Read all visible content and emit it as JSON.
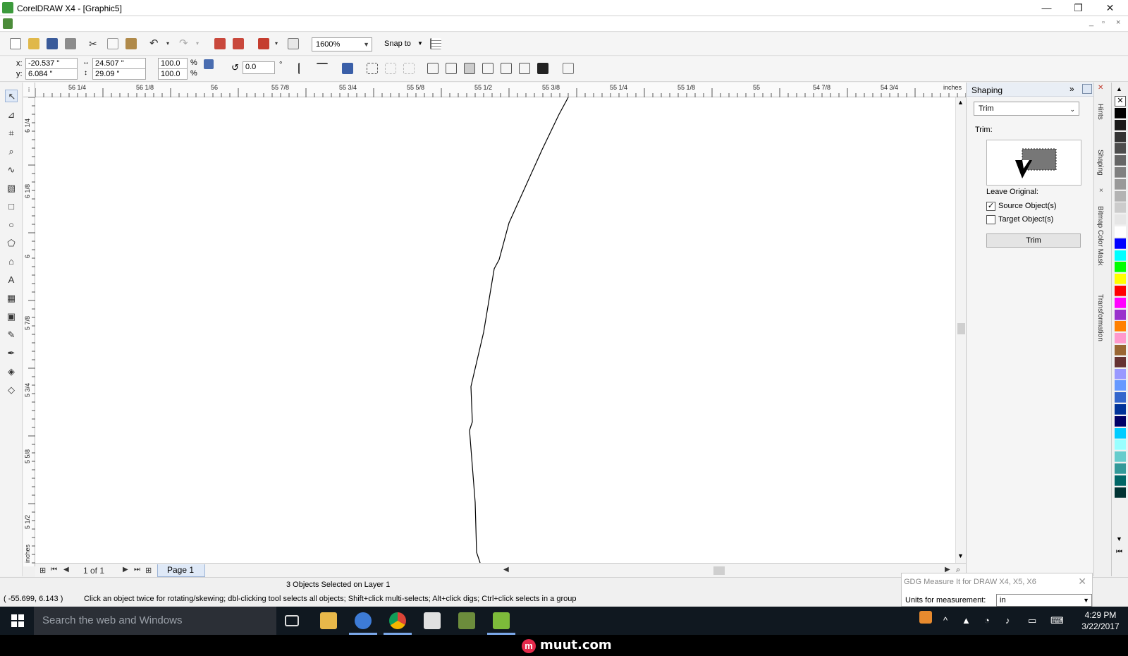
{
  "window": {
    "title": "CorelDRAW X4 - [Graphic5]",
    "minimize": "—",
    "restore": "❐",
    "close": "✕"
  },
  "toolbar": {
    "zoom": "1600%",
    "snap_to": "Snap to"
  },
  "properties": {
    "x_label": "x:",
    "x_value": "-20.537 \"",
    "y_label": "y:",
    "y_value": "6.084 \"",
    "width_value": "24.507 \"",
    "height_value": "29.09 \"",
    "scale_x": "100.0",
    "scale_y": "100.0",
    "percent": "%",
    "rotation": "0.0",
    "degree": "°"
  },
  "hruler": {
    "labels": [
      "56 1/4",
      "56 1/8",
      "56",
      "55 7/8",
      "55 3/4",
      "55 5/8",
      "55 1/2",
      "55 3/8",
      "55 1/4",
      "55 1/8",
      "55",
      "54 7/8",
      "54 3/4"
    ],
    "unit": "inches"
  },
  "vruler": {
    "labels": [
      "6 1/4",
      "6 1/8",
      "6",
      "5 7/8",
      "5 3/4",
      "5 5/8",
      "5 1/2"
    ],
    "unit": "inches"
  },
  "page_nav": {
    "count": "1 of 1",
    "tab": "Page 1"
  },
  "docker": {
    "title": "Shaping",
    "mode": "Trim",
    "section_label": "Trim:",
    "leave_original": "Leave Original:",
    "source_label": "Source Object(s)",
    "source_checked": true,
    "target_label": "Target Object(s)",
    "target_checked": false,
    "button": "Trim"
  },
  "side_tabs": [
    "Hints",
    "Shaping",
    "Bitmap Color Mask",
    "Transformation"
  ],
  "palette": [
    "#000000",
    "#1a1a1a",
    "#333333",
    "#4d4d4d",
    "#666666",
    "#808080",
    "#999999",
    "#b3b3b3",
    "#cccccc",
    "#e6e6e6",
    "#ffffff",
    "#0000ff",
    "#00ffff",
    "#00ff00",
    "#ffff00",
    "#ff0000",
    "#ff00ff",
    "#9933cc",
    "#ff8000",
    "#ff99cc",
    "#996633",
    "#663333",
    "#9999ff",
    "#6699ff",
    "#3366cc",
    "#003399",
    "#000066",
    "#00ccff",
    "#99ffff",
    "#66cccc",
    "#339999",
    "#006666",
    "#003333"
  ],
  "status": {
    "selection": "3 Objects Selected on Layer 1",
    "coords": "( -55.699, 6.143 )",
    "hint": "Click an object twice for rotating/skewing; dbl-clicking tool selects all objects; Shift+click multi-selects; Alt+click digs; Ctrl+click selects in a group"
  },
  "gdg": {
    "title": "GDG Measure It for DRAW X4, X5, X6",
    "units_label": "Units for measurement:",
    "units_value": "in"
  },
  "taskbar": {
    "search_placeholder": "Search the web and Windows",
    "time": "4:29 PM",
    "date": "3/22/2017"
  },
  "watermark": {
    "text": "muut.com",
    "logo_letter": "m"
  }
}
